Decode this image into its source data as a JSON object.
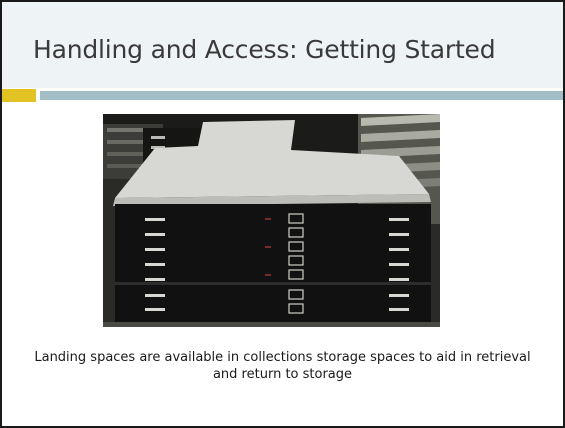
{
  "slide": {
    "title": "Handling and Access: Getting Started",
    "caption": "Landing spaces are available in collections storage spaces to aid in retrieval and return to storage"
  },
  "photo": {
    "subject": "flat-file-cabinet-with-landing-surface"
  },
  "colors": {
    "title_band": "#eef3f6",
    "title_text": "#3a3a3a",
    "accent_gold": "#e3c224",
    "accent_teal": "#a2bec7",
    "border": "#1a1a1a"
  }
}
